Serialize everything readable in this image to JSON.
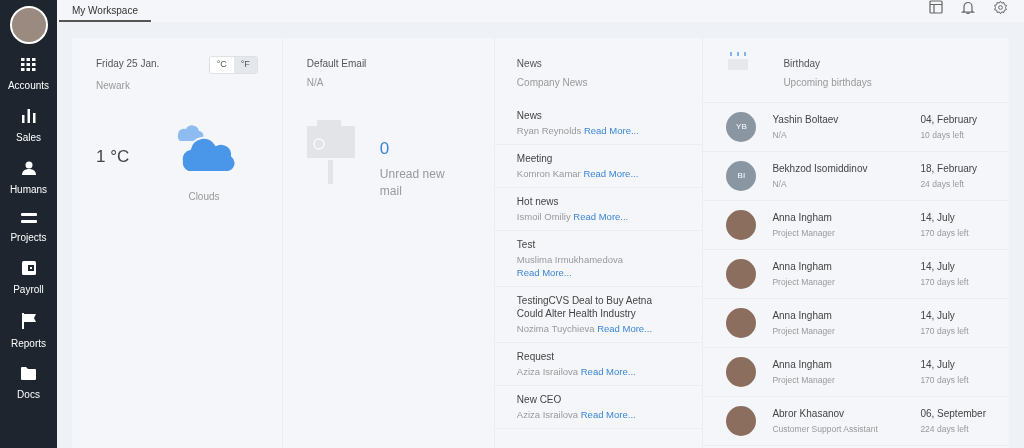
{
  "sidebar": {
    "items": [
      {
        "label": "Accounts"
      },
      {
        "label": "Sales"
      },
      {
        "label": "Humans"
      },
      {
        "label": "Projects"
      },
      {
        "label": "Payroll"
      },
      {
        "label": "Reports"
      },
      {
        "label": "Docs"
      }
    ]
  },
  "tabs": [
    {
      "label": "My Workspace",
      "selected": true
    }
  ],
  "weather": {
    "date": "Friday 25 Jan.",
    "city": "Newark",
    "units": [
      {
        "label": "°C",
        "selected": false
      },
      {
        "label": "°F",
        "selected": true
      }
    ],
    "temperature": "1 °C",
    "condition": "Clouds"
  },
  "email": {
    "title": "Default Email",
    "address": "N/A",
    "count": "0",
    "caption": "Unread new mail"
  },
  "news": {
    "title": "News",
    "subtitle": "Company News",
    "items": [
      {
        "title": "News",
        "author": "Ryan Reynolds",
        "link": "Read More..."
      },
      {
        "title": "Meeting",
        "author": "Komron Kamar",
        "link": "Read More..."
      },
      {
        "title": "Hot news",
        "author": "Ismoil Omiliy",
        "link": "Read More..."
      },
      {
        "title": "Test",
        "author": "Muslima Irmukhamedova",
        "link": "Read More..."
      },
      {
        "title": "TestingCVS Deal to Buy Aetna Could Alter Health Industry",
        "author": "Nozima Tuychieva",
        "link": "Read More..."
      },
      {
        "title": "Request",
        "author": "Aziza Israilova",
        "link": "Read More..."
      },
      {
        "title": "New CEO",
        "author": "Aziza Israilova",
        "link": "Read More..."
      }
    ]
  },
  "birthday": {
    "title": "Birthday",
    "subtitle": "Upcoming birthdays",
    "people": [
      {
        "kind": "initials",
        "initials": "YB",
        "name": "Yashin Boltaev",
        "role": "N/A",
        "date": "04, February",
        "left": "10 days left"
      },
      {
        "kind": "initials",
        "initials": "BI",
        "name": "Bekhzod Isomiddinov",
        "role": "N/A",
        "date": "18, February",
        "left": "24 days left"
      },
      {
        "kind": "photo",
        "name": "Anna Ingham",
        "role": "Project Manager",
        "date": "14, July",
        "left": "170 days left"
      },
      {
        "kind": "photo",
        "name": "Anna Ingham",
        "role": "Project Manager",
        "date": "14, July",
        "left": "170 days left"
      },
      {
        "kind": "photo",
        "name": "Anna Ingham",
        "role": "Project Manager",
        "date": "14, July",
        "left": "170 days left"
      },
      {
        "kind": "photo",
        "name": "Anna Ingham",
        "role": "Project Manager",
        "date": "14, July",
        "left": "170 days left"
      },
      {
        "kind": "photo",
        "name": "Abror Khasanov",
        "role": "Customer Support Assistant",
        "date": "06, September",
        "left": "224 days left"
      }
    ]
  }
}
